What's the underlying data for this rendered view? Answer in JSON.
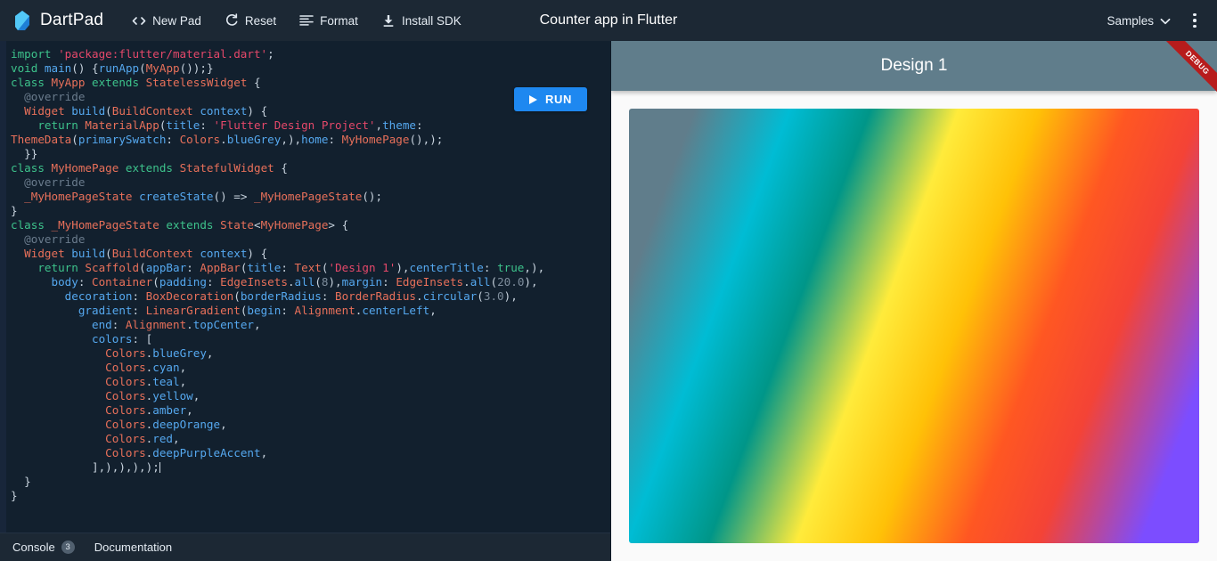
{
  "header": {
    "brand": "DartPad",
    "logo_icon": "dart-logo-icon",
    "title": "Counter app in Flutter",
    "buttons": [
      {
        "label": "New Pad",
        "icon": "code-brackets-icon"
      },
      {
        "label": "Reset",
        "icon": "refresh-icon"
      },
      {
        "label": "Format",
        "icon": "format-align-icon"
      },
      {
        "label": "Install SDK",
        "icon": "download-icon"
      }
    ],
    "samples_label": "Samples",
    "samples_icon": "chevron-down-icon",
    "overflow_icon": "kebab-menu-icon"
  },
  "editor": {
    "run_label": "RUN",
    "run_icon": "play-triangle-icon",
    "lines": [
      [
        {
          "t": "import ",
          "c": "k"
        },
        {
          "t": "'package:flutter/material.dart'",
          "c": "str"
        },
        {
          "t": ";",
          "c": "pln"
        }
      ],
      [
        {
          "t": "void ",
          "c": "k"
        },
        {
          "t": "main",
          "c": "fn"
        },
        {
          "t": "() {",
          "c": "pln"
        },
        {
          "t": "runApp",
          "c": "fn"
        },
        {
          "t": "(",
          "c": "pln"
        },
        {
          "t": "MyApp",
          "c": "typ"
        },
        {
          "t": "());}",
          "c": "pln"
        }
      ],
      [
        {
          "t": "class ",
          "c": "k"
        },
        {
          "t": "MyApp ",
          "c": "typ"
        },
        {
          "t": "extends ",
          "c": "k"
        },
        {
          "t": "StatelessWidget",
          "c": "typ"
        },
        {
          "t": " {",
          "c": "pln"
        }
      ],
      [
        {
          "t": "  @override",
          "c": "cmt"
        }
      ],
      [
        {
          "t": "  ",
          "c": "pln"
        },
        {
          "t": "Widget ",
          "c": "typ"
        },
        {
          "t": "build",
          "c": "fn"
        },
        {
          "t": "(",
          "c": "pln"
        },
        {
          "t": "BuildContext ",
          "c": "typ"
        },
        {
          "t": "context",
          "c": "fn"
        },
        {
          "t": ") {",
          "c": "pln"
        }
      ],
      [
        {
          "t": "    ",
          "c": "pln"
        },
        {
          "t": "return ",
          "c": "k"
        },
        {
          "t": "MaterialApp",
          "c": "typ"
        },
        {
          "t": "(",
          "c": "pln"
        },
        {
          "t": "title",
          "c": "prop"
        },
        {
          "t": ": ",
          "c": "pln"
        },
        {
          "t": "'Flutter Design Project'",
          "c": "str"
        },
        {
          "t": ",",
          "c": "pln"
        },
        {
          "t": "theme",
          "c": "prop"
        },
        {
          "t": ":",
          "c": "pln"
        }
      ],
      [
        {
          "t": "ThemeData",
          "c": "typ"
        },
        {
          "t": "(",
          "c": "pln"
        },
        {
          "t": "primarySwatch",
          "c": "prop"
        },
        {
          "t": ": ",
          "c": "pln"
        },
        {
          "t": "Colors",
          "c": "typ"
        },
        {
          "t": ".",
          "c": "pln"
        },
        {
          "t": "blueGrey",
          "c": "fn"
        },
        {
          "t": ",),",
          "c": "pln"
        },
        {
          "t": "home",
          "c": "prop"
        },
        {
          "t": ": ",
          "c": "pln"
        },
        {
          "t": "MyHomePage",
          "c": "typ"
        },
        {
          "t": "(),);",
          "c": "pln"
        }
      ],
      [
        {
          "t": "  }}",
          "c": "pln"
        }
      ],
      [
        {
          "t": "class ",
          "c": "k"
        },
        {
          "t": "MyHomePage ",
          "c": "typ"
        },
        {
          "t": "extends ",
          "c": "k"
        },
        {
          "t": "StatefulWidget",
          "c": "typ"
        },
        {
          "t": " {",
          "c": "pln"
        }
      ],
      [
        {
          "t": "  @override",
          "c": "cmt"
        }
      ],
      [
        {
          "t": "  ",
          "c": "pln"
        },
        {
          "t": "_MyHomePageState ",
          "c": "typ"
        },
        {
          "t": "createState",
          "c": "fn"
        },
        {
          "t": "() => ",
          "c": "pln"
        },
        {
          "t": "_MyHomePageState",
          "c": "typ"
        },
        {
          "t": "();",
          "c": "pln"
        }
      ],
      [
        {
          "t": "}",
          "c": "pln"
        }
      ],
      [
        {
          "t": "class ",
          "c": "k"
        },
        {
          "t": "_MyHomePageState ",
          "c": "typ"
        },
        {
          "t": "extends ",
          "c": "k"
        },
        {
          "t": "State",
          "c": "typ"
        },
        {
          "t": "<",
          "c": "pln"
        },
        {
          "t": "MyHomePage",
          "c": "typ"
        },
        {
          "t": "> {",
          "c": "pln"
        }
      ],
      [
        {
          "t": "  @override",
          "c": "cmt"
        }
      ],
      [
        {
          "t": "  ",
          "c": "pln"
        },
        {
          "t": "Widget ",
          "c": "typ"
        },
        {
          "t": "build",
          "c": "fn"
        },
        {
          "t": "(",
          "c": "pln"
        },
        {
          "t": "BuildContext ",
          "c": "typ"
        },
        {
          "t": "context",
          "c": "fn"
        },
        {
          "t": ") {",
          "c": "pln"
        }
      ],
      [
        {
          "t": "    ",
          "c": "pln"
        },
        {
          "t": "return ",
          "c": "k"
        },
        {
          "t": "Scaffold",
          "c": "typ"
        },
        {
          "t": "(",
          "c": "pln"
        },
        {
          "t": "appBar",
          "c": "prop"
        },
        {
          "t": ": ",
          "c": "pln"
        },
        {
          "t": "AppBar",
          "c": "typ"
        },
        {
          "t": "(",
          "c": "pln"
        },
        {
          "t": "title",
          "c": "prop"
        },
        {
          "t": ": ",
          "c": "pln"
        },
        {
          "t": "Text",
          "c": "typ"
        },
        {
          "t": "(",
          "c": "pln"
        },
        {
          "t": "'Design 1'",
          "c": "str"
        },
        {
          "t": "),",
          "c": "pln"
        },
        {
          "t": "centerTitle",
          "c": "prop"
        },
        {
          "t": ": ",
          "c": "pln"
        },
        {
          "t": "true",
          "c": "k"
        },
        {
          "t": ",),",
          "c": "pln"
        }
      ],
      [
        {
          "t": "      ",
          "c": "pln"
        },
        {
          "t": "body",
          "c": "prop"
        },
        {
          "t": ": ",
          "c": "pln"
        },
        {
          "t": "Container",
          "c": "typ"
        },
        {
          "t": "(",
          "c": "pln"
        },
        {
          "t": "padding",
          "c": "prop"
        },
        {
          "t": ": ",
          "c": "pln"
        },
        {
          "t": "EdgeInsets",
          "c": "typ"
        },
        {
          "t": ".",
          "c": "pln"
        },
        {
          "t": "all",
          "c": "fn"
        },
        {
          "t": "(",
          "c": "pln"
        },
        {
          "t": "8",
          "c": "num"
        },
        {
          "t": "),",
          "c": "pln"
        },
        {
          "t": "margin",
          "c": "prop"
        },
        {
          "t": ": ",
          "c": "pln"
        },
        {
          "t": "EdgeInsets",
          "c": "typ"
        },
        {
          "t": ".",
          "c": "pln"
        },
        {
          "t": "all",
          "c": "fn"
        },
        {
          "t": "(",
          "c": "pln"
        },
        {
          "t": "20.0",
          "c": "num"
        },
        {
          "t": "),",
          "c": "pln"
        }
      ],
      [
        {
          "t": "        ",
          "c": "pln"
        },
        {
          "t": "decoration",
          "c": "prop"
        },
        {
          "t": ": ",
          "c": "pln"
        },
        {
          "t": "BoxDecoration",
          "c": "typ"
        },
        {
          "t": "(",
          "c": "pln"
        },
        {
          "t": "borderRadius",
          "c": "prop"
        },
        {
          "t": ": ",
          "c": "pln"
        },
        {
          "t": "BorderRadius",
          "c": "typ"
        },
        {
          "t": ".",
          "c": "pln"
        },
        {
          "t": "circular",
          "c": "fn"
        },
        {
          "t": "(",
          "c": "pln"
        },
        {
          "t": "3.0",
          "c": "num"
        },
        {
          "t": "),",
          "c": "pln"
        }
      ],
      [
        {
          "t": "          ",
          "c": "pln"
        },
        {
          "t": "gradient",
          "c": "prop"
        },
        {
          "t": ": ",
          "c": "pln"
        },
        {
          "t": "LinearGradient",
          "c": "typ"
        },
        {
          "t": "(",
          "c": "pln"
        },
        {
          "t": "begin",
          "c": "prop"
        },
        {
          "t": ": ",
          "c": "pln"
        },
        {
          "t": "Alignment",
          "c": "typ"
        },
        {
          "t": ".",
          "c": "pln"
        },
        {
          "t": "centerLeft",
          "c": "fn"
        },
        {
          "t": ",",
          "c": "pln"
        }
      ],
      [
        {
          "t": "            ",
          "c": "pln"
        },
        {
          "t": "end",
          "c": "prop"
        },
        {
          "t": ": ",
          "c": "pln"
        },
        {
          "t": "Alignment",
          "c": "typ"
        },
        {
          "t": ".",
          "c": "pln"
        },
        {
          "t": "topCenter",
          "c": "fn"
        },
        {
          "t": ",",
          "c": "pln"
        }
      ],
      [
        {
          "t": "            ",
          "c": "pln"
        },
        {
          "t": "colors",
          "c": "prop"
        },
        {
          "t": ": [",
          "c": "pln"
        }
      ],
      [
        {
          "t": "              ",
          "c": "pln"
        },
        {
          "t": "Colors",
          "c": "typ"
        },
        {
          "t": ".",
          "c": "pln"
        },
        {
          "t": "blueGrey",
          "c": "fn"
        },
        {
          "t": ",",
          "c": "pln"
        }
      ],
      [
        {
          "t": "              ",
          "c": "pln"
        },
        {
          "t": "Colors",
          "c": "typ"
        },
        {
          "t": ".",
          "c": "pln"
        },
        {
          "t": "cyan",
          "c": "fn"
        },
        {
          "t": ",",
          "c": "pln"
        }
      ],
      [
        {
          "t": "              ",
          "c": "pln"
        },
        {
          "t": "Colors",
          "c": "typ"
        },
        {
          "t": ".",
          "c": "pln"
        },
        {
          "t": "teal",
          "c": "fn"
        },
        {
          "t": ",",
          "c": "pln"
        }
      ],
      [
        {
          "t": "              ",
          "c": "pln"
        },
        {
          "t": "Colors",
          "c": "typ"
        },
        {
          "t": ".",
          "c": "pln"
        },
        {
          "t": "yellow",
          "c": "fn"
        },
        {
          "t": ",",
          "c": "pln"
        }
      ],
      [
        {
          "t": "              ",
          "c": "pln"
        },
        {
          "t": "Colors",
          "c": "typ"
        },
        {
          "t": ".",
          "c": "pln"
        },
        {
          "t": "amber",
          "c": "fn"
        },
        {
          "t": ",",
          "c": "pln"
        }
      ],
      [
        {
          "t": "              ",
          "c": "pln"
        },
        {
          "t": "Colors",
          "c": "typ"
        },
        {
          "t": ".",
          "c": "pln"
        },
        {
          "t": "deepOrange",
          "c": "fn"
        },
        {
          "t": ",",
          "c": "pln"
        }
      ],
      [
        {
          "t": "              ",
          "c": "pln"
        },
        {
          "t": "Colors",
          "c": "typ"
        },
        {
          "t": ".",
          "c": "pln"
        },
        {
          "t": "red",
          "c": "fn"
        },
        {
          "t": ",",
          "c": "pln"
        }
      ],
      [
        {
          "t": "              ",
          "c": "pln"
        },
        {
          "t": "Colors",
          "c": "typ"
        },
        {
          "t": ".",
          "c": "pln"
        },
        {
          "t": "deepPurpleAccent",
          "c": "fn"
        },
        {
          "t": ",",
          "c": "pln"
        }
      ],
      [
        {
          "t": "            ],),),),);",
          "c": "pln"
        },
        {
          "t": "",
          "c": "caret"
        }
      ],
      [
        {
          "t": "  }",
          "c": "pln"
        }
      ],
      [
        {
          "t": "}",
          "c": "pln"
        }
      ]
    ]
  },
  "bottom": {
    "console_label": "Console",
    "console_badge": "3",
    "documentation_label": "Documentation"
  },
  "preview": {
    "appbar_title": "Design 1",
    "debug_label": "DEBUG",
    "gradient_colors": [
      "#607d8b",
      "#00bcd4",
      "#009688",
      "#ffeb3b",
      "#ffc107",
      "#ff5722",
      "#f44336",
      "#7c4dff"
    ]
  }
}
